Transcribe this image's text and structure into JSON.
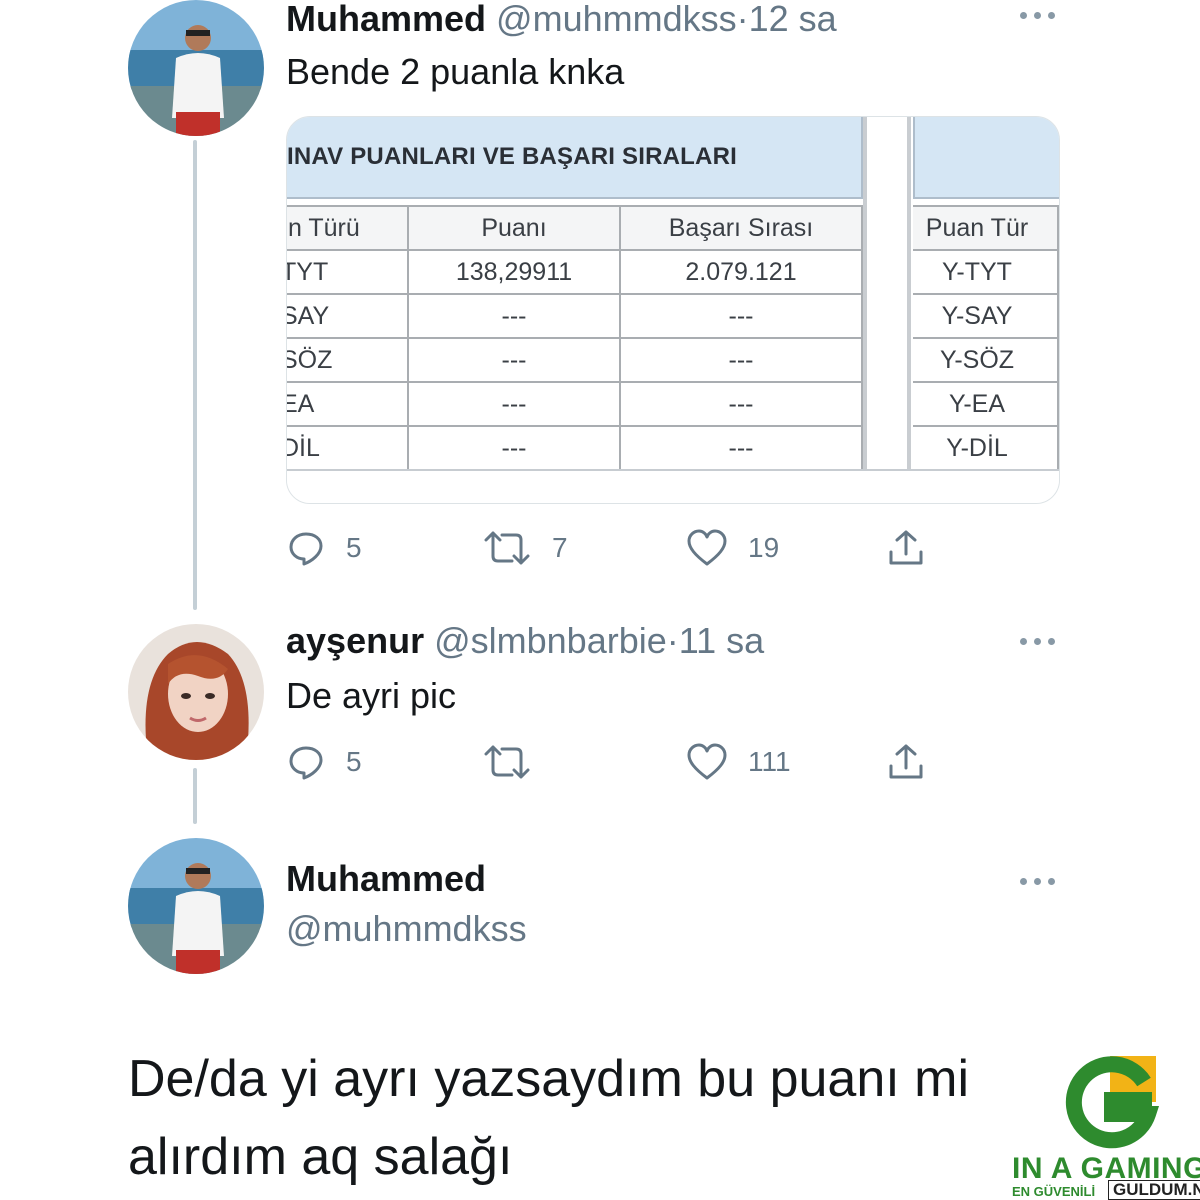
{
  "tweet1": {
    "name": "Muhammed",
    "handle": "@muhmmdkss",
    "separator": "·",
    "time": "12 sa",
    "text": "Bende 2 puanla knka",
    "media": {
      "title": "INAV PUANLARI VE BAŞARI SIRALARI",
      "left_headers": [
        "ın Türü",
        "Puanı",
        "Başarı Sırası"
      ],
      "left_rows": [
        [
          "TYT",
          "138,29911",
          "2.079.121"
        ],
        [
          "SAY",
          "---",
          "---"
        ],
        [
          "SÖZ",
          "---",
          "---"
        ],
        [
          "EA",
          "---",
          "---"
        ],
        [
          "DİL",
          "---",
          "---"
        ]
      ],
      "right_header": "Puan Tür",
      "right_rows": [
        "Y-TYT",
        "Y-SAY",
        "Y-SÖZ",
        "Y-EA",
        "Y-DİL"
      ]
    },
    "replies": "5",
    "retweets": "7",
    "likes": "19"
  },
  "tweet2": {
    "name": "ayşenur",
    "handle": "@slmbnbarbie",
    "separator": "·",
    "time": "11 sa",
    "text": "De ayri pic",
    "replies": "5",
    "retweets": "",
    "likes": "111"
  },
  "tweet3": {
    "name": "Muhammed",
    "handle": "@muhmmdkss",
    "text": "De/da yi ayrı yazsaydım bu puanı mi alırdım aq salağı"
  },
  "watermark": {
    "brand": "IN A GAMING",
    "sub": "EN GÜVENİLİ",
    "site": "GULDUM.NET"
  },
  "colors": {
    "text": "#14171a",
    "secondary": "#657786",
    "thread_line": "#c4cfd6",
    "watermark_green": "#2e8b2e"
  },
  "icons": [
    "reply-icon",
    "retweet-icon",
    "like-icon",
    "share-icon",
    "more-icon"
  ]
}
